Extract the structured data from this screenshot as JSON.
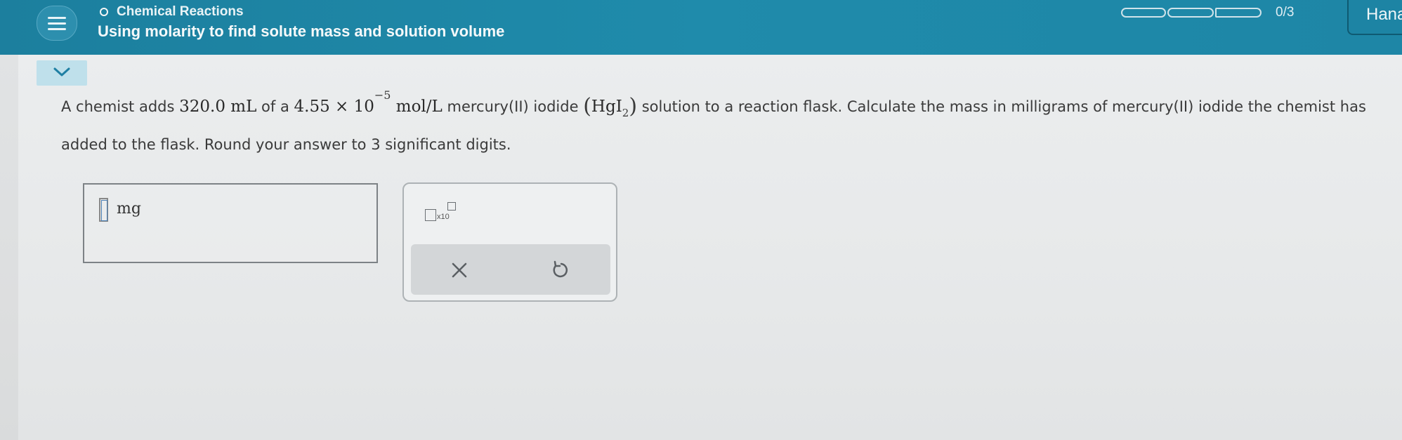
{
  "header": {
    "topic": "Chemical Reactions",
    "title": "Using molarity to find solute mass and solution volume",
    "progress": {
      "completed": 0,
      "total": 3,
      "label": "0/3"
    },
    "user_name": "Hana"
  },
  "question": {
    "intro": "A chemist adds ",
    "volume": "320.0 mL",
    "text_of_a": " of a ",
    "conc_mantissa": "4.55 × 10",
    "conc_exponent": "−5",
    "conc_unit": " mol/L",
    "compound_name": " mercury(II) iodide ",
    "formula_open": "(",
    "formula_main": "HgI",
    "formula_sub": "2",
    "formula_close": ")",
    "text_rest": " solution to a reaction flask. Calculate the mass in milligrams of mercury(II) iodide the chemist has added to the flask. Round your answer to 3 significant digits."
  },
  "answer": {
    "value": "",
    "unit": "mg"
  },
  "tools": {
    "sci_label": "x10"
  },
  "icons": {
    "menu": "hamburger-icon",
    "collapse": "chevron-down-icon",
    "topic": "circle-icon",
    "clear": "close-icon",
    "undo": "undo-icon"
  },
  "colors": {
    "header": "#1f8bab",
    "collapse_button": "#bfe0eb",
    "background": "#e9ebec"
  }
}
